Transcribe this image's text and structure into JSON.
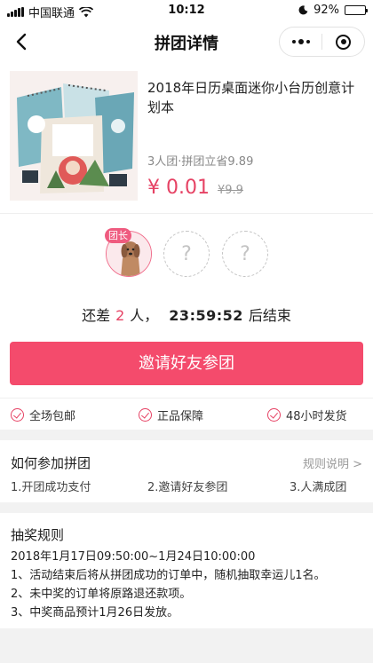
{
  "status_bar": {
    "carrier": "中国联通",
    "time": "10:12",
    "battery": "92%",
    "battery_level": 0.92
  },
  "nav": {
    "title": "拼团详情",
    "back_icon": "chevron-left-icon",
    "more_icon": "more-dots-icon",
    "home_icon": "target-circle-icon"
  },
  "product": {
    "title": "2018年日历桌面迷你小台历创意计划本",
    "subtitle": "3人团·拼团立省9.89",
    "price_symbol": "¥",
    "price": "0.01",
    "original_price": "9.9"
  },
  "group": {
    "leader_tag": "团长",
    "empty_slot_symbol": "?",
    "countdown_prefix": "还差",
    "remaining": "2",
    "countdown_unit": "人，",
    "time_left": "23:59:52",
    "countdown_suffix": "后结束"
  },
  "invite_button": "邀请好友参团",
  "guarantees": [
    "全场包邮",
    "正品保障",
    "48小时发货"
  ],
  "how_to": {
    "title": "如何参加拼团",
    "rules_link": "规则说明 >",
    "steps": [
      "1.开团成功支付",
      "2.邀请好友参团",
      "3.人满成团"
    ]
  },
  "lottery": {
    "title": "抽奖规则",
    "lines": [
      "2018年1月17日09:50:00~1月24日10:00:00",
      "1、活动结束后将从拼团成功的订单中，随机抽取幸运儿1名。",
      "2、未中奖的订单将原路退还款项。",
      "3、中奖商品预计1月26日发放。"
    ]
  },
  "colors": {
    "accent": "#f44b6c",
    "price": "#e64264",
    "page_bg": "#f2f2f2"
  }
}
